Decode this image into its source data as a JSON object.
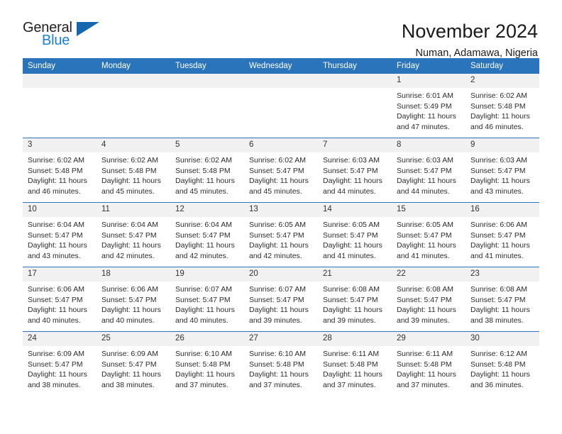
{
  "brand": {
    "name_part1": "General",
    "name_part2": "Blue",
    "triangle_icon": "blue-triangle-logo-mark",
    "colors": {
      "dark": "#231f20",
      "blue": "#1a7fd4",
      "triangle": "#1668ae"
    }
  },
  "header": {
    "title": "November 2024",
    "subtitle": "Numan, Adamawa, Nigeria"
  },
  "calendar": {
    "header_background": "#2a74bb",
    "daynum_background": "#f1f1f1",
    "weekday_headers": [
      "Sunday",
      "Monday",
      "Tuesday",
      "Wednesday",
      "Thursday",
      "Friday",
      "Saturday"
    ],
    "weeks": [
      [
        {
          "day": "",
          "empty": true,
          "sunrise": "",
          "sunset": "",
          "daylight_1": "",
          "daylight_2": ""
        },
        {
          "day": "",
          "empty": true,
          "sunrise": "",
          "sunset": "",
          "daylight_1": "",
          "daylight_2": ""
        },
        {
          "day": "",
          "empty": true,
          "sunrise": "",
          "sunset": "",
          "daylight_1": "",
          "daylight_2": ""
        },
        {
          "day": "",
          "empty": true,
          "sunrise": "",
          "sunset": "",
          "daylight_1": "",
          "daylight_2": ""
        },
        {
          "day": "",
          "empty": true,
          "sunrise": "",
          "sunset": "",
          "daylight_1": "",
          "daylight_2": ""
        },
        {
          "day": "1",
          "empty": false,
          "sunrise": "Sunrise: 6:01 AM",
          "sunset": "Sunset: 5:49 PM",
          "daylight_1": "Daylight: 11 hours",
          "daylight_2": "and 47 minutes."
        },
        {
          "day": "2",
          "empty": false,
          "sunrise": "Sunrise: 6:02 AM",
          "sunset": "Sunset: 5:48 PM",
          "daylight_1": "Daylight: 11 hours",
          "daylight_2": "and 46 minutes."
        }
      ],
      [
        {
          "day": "3",
          "empty": false,
          "sunrise": "Sunrise: 6:02 AM",
          "sunset": "Sunset: 5:48 PM",
          "daylight_1": "Daylight: 11 hours",
          "daylight_2": "and 46 minutes."
        },
        {
          "day": "4",
          "empty": false,
          "sunrise": "Sunrise: 6:02 AM",
          "sunset": "Sunset: 5:48 PM",
          "daylight_1": "Daylight: 11 hours",
          "daylight_2": "and 45 minutes."
        },
        {
          "day": "5",
          "empty": false,
          "sunrise": "Sunrise: 6:02 AM",
          "sunset": "Sunset: 5:48 PM",
          "daylight_1": "Daylight: 11 hours",
          "daylight_2": "and 45 minutes."
        },
        {
          "day": "6",
          "empty": false,
          "sunrise": "Sunrise: 6:02 AM",
          "sunset": "Sunset: 5:47 PM",
          "daylight_1": "Daylight: 11 hours",
          "daylight_2": "and 45 minutes."
        },
        {
          "day": "7",
          "empty": false,
          "sunrise": "Sunrise: 6:03 AM",
          "sunset": "Sunset: 5:47 PM",
          "daylight_1": "Daylight: 11 hours",
          "daylight_2": "and 44 minutes."
        },
        {
          "day": "8",
          "empty": false,
          "sunrise": "Sunrise: 6:03 AM",
          "sunset": "Sunset: 5:47 PM",
          "daylight_1": "Daylight: 11 hours",
          "daylight_2": "and 44 minutes."
        },
        {
          "day": "9",
          "empty": false,
          "sunrise": "Sunrise: 6:03 AM",
          "sunset": "Sunset: 5:47 PM",
          "daylight_1": "Daylight: 11 hours",
          "daylight_2": "and 43 minutes."
        }
      ],
      [
        {
          "day": "10",
          "empty": false,
          "sunrise": "Sunrise: 6:04 AM",
          "sunset": "Sunset: 5:47 PM",
          "daylight_1": "Daylight: 11 hours",
          "daylight_2": "and 43 minutes."
        },
        {
          "day": "11",
          "empty": false,
          "sunrise": "Sunrise: 6:04 AM",
          "sunset": "Sunset: 5:47 PM",
          "daylight_1": "Daylight: 11 hours",
          "daylight_2": "and 42 minutes."
        },
        {
          "day": "12",
          "empty": false,
          "sunrise": "Sunrise: 6:04 AM",
          "sunset": "Sunset: 5:47 PM",
          "daylight_1": "Daylight: 11 hours",
          "daylight_2": "and 42 minutes."
        },
        {
          "day": "13",
          "empty": false,
          "sunrise": "Sunrise: 6:05 AM",
          "sunset": "Sunset: 5:47 PM",
          "daylight_1": "Daylight: 11 hours",
          "daylight_2": "and 42 minutes."
        },
        {
          "day": "14",
          "empty": false,
          "sunrise": "Sunrise: 6:05 AM",
          "sunset": "Sunset: 5:47 PM",
          "daylight_1": "Daylight: 11 hours",
          "daylight_2": "and 41 minutes."
        },
        {
          "day": "15",
          "empty": false,
          "sunrise": "Sunrise: 6:05 AM",
          "sunset": "Sunset: 5:47 PM",
          "daylight_1": "Daylight: 11 hours",
          "daylight_2": "and 41 minutes."
        },
        {
          "day": "16",
          "empty": false,
          "sunrise": "Sunrise: 6:06 AM",
          "sunset": "Sunset: 5:47 PM",
          "daylight_1": "Daylight: 11 hours",
          "daylight_2": "and 41 minutes."
        }
      ],
      [
        {
          "day": "17",
          "empty": false,
          "sunrise": "Sunrise: 6:06 AM",
          "sunset": "Sunset: 5:47 PM",
          "daylight_1": "Daylight: 11 hours",
          "daylight_2": "and 40 minutes."
        },
        {
          "day": "18",
          "empty": false,
          "sunrise": "Sunrise: 6:06 AM",
          "sunset": "Sunset: 5:47 PM",
          "daylight_1": "Daylight: 11 hours",
          "daylight_2": "and 40 minutes."
        },
        {
          "day": "19",
          "empty": false,
          "sunrise": "Sunrise: 6:07 AM",
          "sunset": "Sunset: 5:47 PM",
          "daylight_1": "Daylight: 11 hours",
          "daylight_2": "and 40 minutes."
        },
        {
          "day": "20",
          "empty": false,
          "sunrise": "Sunrise: 6:07 AM",
          "sunset": "Sunset: 5:47 PM",
          "daylight_1": "Daylight: 11 hours",
          "daylight_2": "and 39 minutes."
        },
        {
          "day": "21",
          "empty": false,
          "sunrise": "Sunrise: 6:08 AM",
          "sunset": "Sunset: 5:47 PM",
          "daylight_1": "Daylight: 11 hours",
          "daylight_2": "and 39 minutes."
        },
        {
          "day": "22",
          "empty": false,
          "sunrise": "Sunrise: 6:08 AM",
          "sunset": "Sunset: 5:47 PM",
          "daylight_1": "Daylight: 11 hours",
          "daylight_2": "and 39 minutes."
        },
        {
          "day": "23",
          "empty": false,
          "sunrise": "Sunrise: 6:08 AM",
          "sunset": "Sunset: 5:47 PM",
          "daylight_1": "Daylight: 11 hours",
          "daylight_2": "and 38 minutes."
        }
      ],
      [
        {
          "day": "24",
          "empty": false,
          "sunrise": "Sunrise: 6:09 AM",
          "sunset": "Sunset: 5:47 PM",
          "daylight_1": "Daylight: 11 hours",
          "daylight_2": "and 38 minutes."
        },
        {
          "day": "25",
          "empty": false,
          "sunrise": "Sunrise: 6:09 AM",
          "sunset": "Sunset: 5:47 PM",
          "daylight_1": "Daylight: 11 hours",
          "daylight_2": "and 38 minutes."
        },
        {
          "day": "26",
          "empty": false,
          "sunrise": "Sunrise: 6:10 AM",
          "sunset": "Sunset: 5:48 PM",
          "daylight_1": "Daylight: 11 hours",
          "daylight_2": "and 37 minutes."
        },
        {
          "day": "27",
          "empty": false,
          "sunrise": "Sunrise: 6:10 AM",
          "sunset": "Sunset: 5:48 PM",
          "daylight_1": "Daylight: 11 hours",
          "daylight_2": "and 37 minutes."
        },
        {
          "day": "28",
          "empty": false,
          "sunrise": "Sunrise: 6:11 AM",
          "sunset": "Sunset: 5:48 PM",
          "daylight_1": "Daylight: 11 hours",
          "daylight_2": "and 37 minutes."
        },
        {
          "day": "29",
          "empty": false,
          "sunrise": "Sunrise: 6:11 AM",
          "sunset": "Sunset: 5:48 PM",
          "daylight_1": "Daylight: 11 hours",
          "daylight_2": "and 37 minutes."
        },
        {
          "day": "30",
          "empty": false,
          "sunrise": "Sunrise: 6:12 AM",
          "sunset": "Sunset: 5:48 PM",
          "daylight_1": "Daylight: 11 hours",
          "daylight_2": "and 36 minutes."
        }
      ]
    ]
  }
}
